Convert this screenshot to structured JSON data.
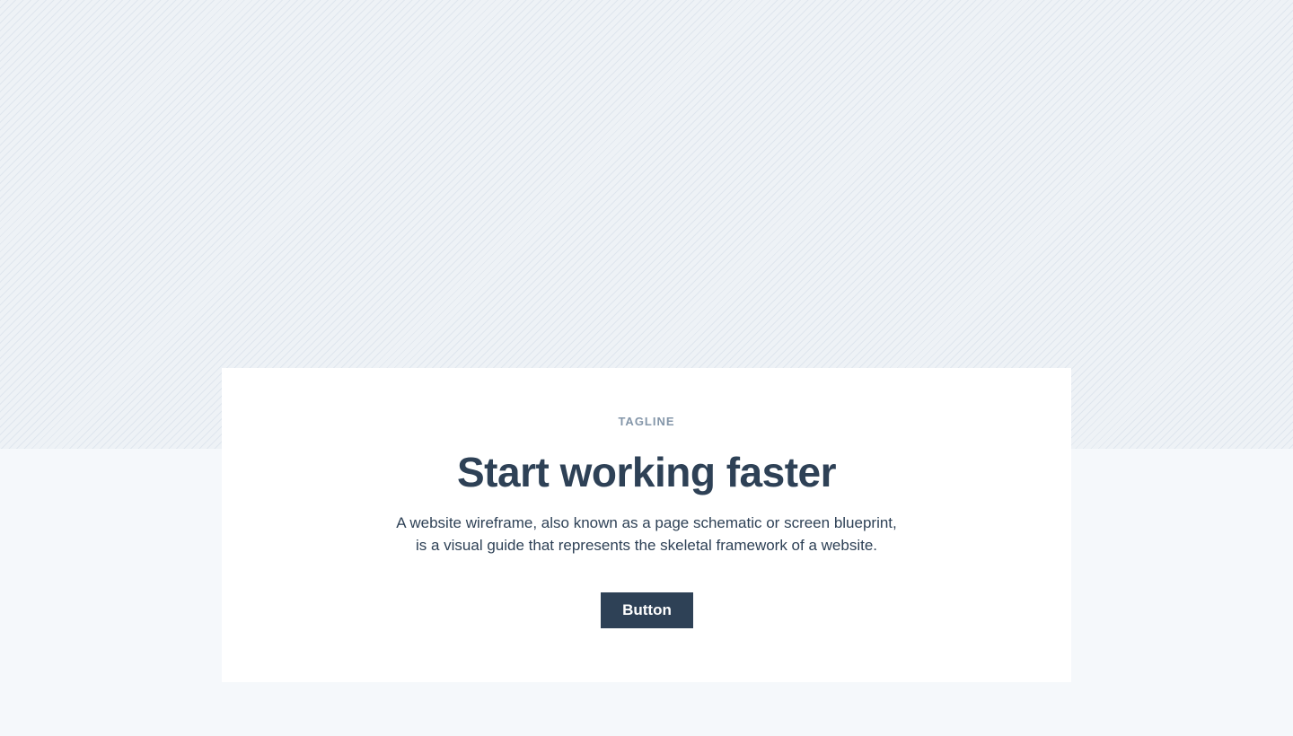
{
  "hero": {
    "tagline": "TAGLINE",
    "title": "Start working faster",
    "description_line1": "A website wireframe, also known as a page schematic or screen blueprint,",
    "description_line2": "is a visual guide that represents the skeletal framework of a website.",
    "button_label": "Button"
  },
  "colors": {
    "page_background": "#f5f8fb",
    "pattern_background": "#eef2f6",
    "pattern_stripe": "#dfe6ee",
    "card_background": "#ffffff",
    "tagline": "#8496a9",
    "text": "#2e4156",
    "button_background": "#2e4156",
    "button_text": "#ffffff"
  }
}
